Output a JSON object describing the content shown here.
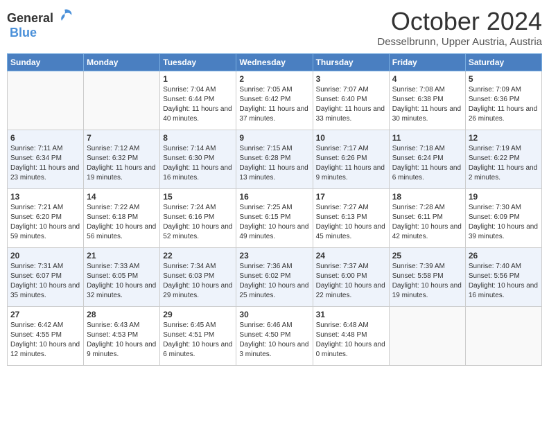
{
  "header": {
    "logo_general": "General",
    "logo_blue": "Blue",
    "month_title": "October 2024",
    "subtitle": "Desselbrunn, Upper Austria, Austria"
  },
  "days_of_week": [
    "Sunday",
    "Monday",
    "Tuesday",
    "Wednesday",
    "Thursday",
    "Friday",
    "Saturday"
  ],
  "weeks": [
    [
      {
        "day": "",
        "info": ""
      },
      {
        "day": "",
        "info": ""
      },
      {
        "day": "1",
        "info": "Sunrise: 7:04 AM\nSunset: 6:44 PM\nDaylight: 11 hours and 40 minutes."
      },
      {
        "day": "2",
        "info": "Sunrise: 7:05 AM\nSunset: 6:42 PM\nDaylight: 11 hours and 37 minutes."
      },
      {
        "day": "3",
        "info": "Sunrise: 7:07 AM\nSunset: 6:40 PM\nDaylight: 11 hours and 33 minutes."
      },
      {
        "day": "4",
        "info": "Sunrise: 7:08 AM\nSunset: 6:38 PM\nDaylight: 11 hours and 30 minutes."
      },
      {
        "day": "5",
        "info": "Sunrise: 7:09 AM\nSunset: 6:36 PM\nDaylight: 11 hours and 26 minutes."
      }
    ],
    [
      {
        "day": "6",
        "info": "Sunrise: 7:11 AM\nSunset: 6:34 PM\nDaylight: 11 hours and 23 minutes."
      },
      {
        "day": "7",
        "info": "Sunrise: 7:12 AM\nSunset: 6:32 PM\nDaylight: 11 hours and 19 minutes."
      },
      {
        "day": "8",
        "info": "Sunrise: 7:14 AM\nSunset: 6:30 PM\nDaylight: 11 hours and 16 minutes."
      },
      {
        "day": "9",
        "info": "Sunrise: 7:15 AM\nSunset: 6:28 PM\nDaylight: 11 hours and 13 minutes."
      },
      {
        "day": "10",
        "info": "Sunrise: 7:17 AM\nSunset: 6:26 PM\nDaylight: 11 hours and 9 minutes."
      },
      {
        "day": "11",
        "info": "Sunrise: 7:18 AM\nSunset: 6:24 PM\nDaylight: 11 hours and 6 minutes."
      },
      {
        "day": "12",
        "info": "Sunrise: 7:19 AM\nSunset: 6:22 PM\nDaylight: 11 hours and 2 minutes."
      }
    ],
    [
      {
        "day": "13",
        "info": "Sunrise: 7:21 AM\nSunset: 6:20 PM\nDaylight: 10 hours and 59 minutes."
      },
      {
        "day": "14",
        "info": "Sunrise: 7:22 AM\nSunset: 6:18 PM\nDaylight: 10 hours and 56 minutes."
      },
      {
        "day": "15",
        "info": "Sunrise: 7:24 AM\nSunset: 6:16 PM\nDaylight: 10 hours and 52 minutes."
      },
      {
        "day": "16",
        "info": "Sunrise: 7:25 AM\nSunset: 6:15 PM\nDaylight: 10 hours and 49 minutes."
      },
      {
        "day": "17",
        "info": "Sunrise: 7:27 AM\nSunset: 6:13 PM\nDaylight: 10 hours and 45 minutes."
      },
      {
        "day": "18",
        "info": "Sunrise: 7:28 AM\nSunset: 6:11 PM\nDaylight: 10 hours and 42 minutes."
      },
      {
        "day": "19",
        "info": "Sunrise: 7:30 AM\nSunset: 6:09 PM\nDaylight: 10 hours and 39 minutes."
      }
    ],
    [
      {
        "day": "20",
        "info": "Sunrise: 7:31 AM\nSunset: 6:07 PM\nDaylight: 10 hours and 35 minutes."
      },
      {
        "day": "21",
        "info": "Sunrise: 7:33 AM\nSunset: 6:05 PM\nDaylight: 10 hours and 32 minutes."
      },
      {
        "day": "22",
        "info": "Sunrise: 7:34 AM\nSunset: 6:03 PM\nDaylight: 10 hours and 29 minutes."
      },
      {
        "day": "23",
        "info": "Sunrise: 7:36 AM\nSunset: 6:02 PM\nDaylight: 10 hours and 25 minutes."
      },
      {
        "day": "24",
        "info": "Sunrise: 7:37 AM\nSunset: 6:00 PM\nDaylight: 10 hours and 22 minutes."
      },
      {
        "day": "25",
        "info": "Sunrise: 7:39 AM\nSunset: 5:58 PM\nDaylight: 10 hours and 19 minutes."
      },
      {
        "day": "26",
        "info": "Sunrise: 7:40 AM\nSunset: 5:56 PM\nDaylight: 10 hours and 16 minutes."
      }
    ],
    [
      {
        "day": "27",
        "info": "Sunrise: 6:42 AM\nSunset: 4:55 PM\nDaylight: 10 hours and 12 minutes."
      },
      {
        "day": "28",
        "info": "Sunrise: 6:43 AM\nSunset: 4:53 PM\nDaylight: 10 hours and 9 minutes."
      },
      {
        "day": "29",
        "info": "Sunrise: 6:45 AM\nSunset: 4:51 PM\nDaylight: 10 hours and 6 minutes."
      },
      {
        "day": "30",
        "info": "Sunrise: 6:46 AM\nSunset: 4:50 PM\nDaylight: 10 hours and 3 minutes."
      },
      {
        "day": "31",
        "info": "Sunrise: 6:48 AM\nSunset: 4:48 PM\nDaylight: 10 hours and 0 minutes."
      },
      {
        "day": "",
        "info": ""
      },
      {
        "day": "",
        "info": ""
      }
    ]
  ]
}
